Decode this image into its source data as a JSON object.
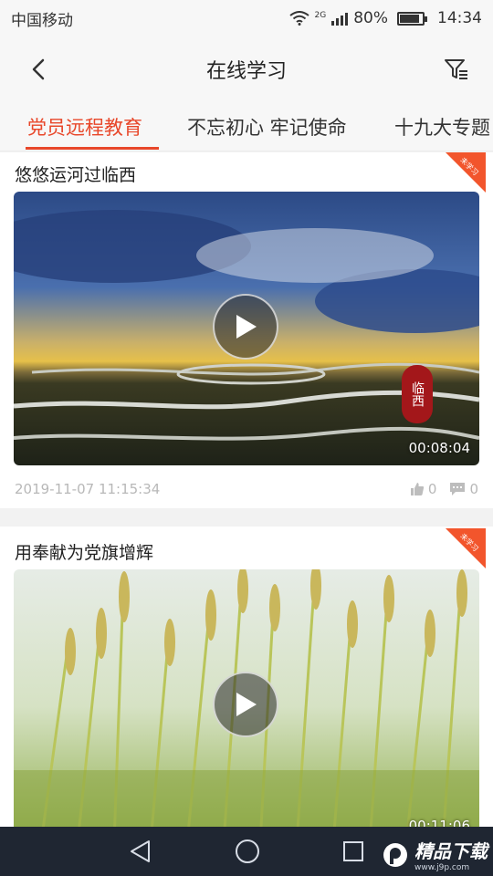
{
  "status": {
    "carrier": "中国移动",
    "network": "2G",
    "battery": "80%",
    "battery_level": 0.8,
    "time": "14:34"
  },
  "nav": {
    "back_icon": "chevron-left-icon",
    "title": "在线学习",
    "filter_icon": "filter-icon"
  },
  "tabs": [
    {
      "label": "党员远程教育",
      "active": true
    },
    {
      "label": "不忘初心 牢记使命",
      "active": false
    },
    {
      "label": "十九大专题",
      "active": false
    }
  ],
  "colors": {
    "accent": "#e8472a",
    "badge": "#f2552c",
    "nav_dark": "#1f2632"
  },
  "videos": [
    {
      "title": "悠悠运河过临西",
      "badge": "未学习",
      "duration": "00:08:04",
      "seal_text": "临西",
      "date": "2019-11-07 11:15:34",
      "likes": "0",
      "comments": "0"
    },
    {
      "title": "用奉献为党旗增辉",
      "badge": "未学习",
      "duration": "00:11:06"
    }
  ],
  "system_nav": {
    "back": "back-triangle-icon",
    "home": "home-circle-icon",
    "recent": "recent-square-icon"
  },
  "watermark": {
    "main": "精品下载",
    "sub": "www.j9p.com"
  }
}
